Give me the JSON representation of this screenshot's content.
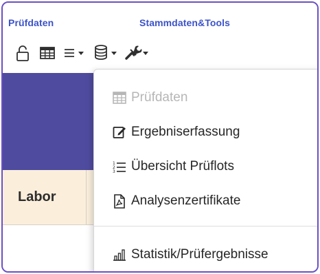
{
  "toolbar": {
    "group1_title": "Prüfdaten",
    "group2_title": "Stammdaten&Tools",
    "icons": [
      "unlock-icon",
      "table-icon",
      "list-dropdown-icon",
      "database-dropdown-icon",
      "tools-dropdown-icon"
    ]
  },
  "table": {
    "labor_header": "Labor"
  },
  "menu": {
    "items": [
      {
        "label": "Prüfdaten",
        "icon": "table-icon",
        "enabled": false
      },
      {
        "label": "Ergebniserfassung",
        "icon": "edit-icon",
        "enabled": true
      },
      {
        "label": "Übersicht Prüflots",
        "icon": "numbered-list-icon",
        "enabled": true
      },
      {
        "label": "Analysenzertifikate",
        "icon": "pdf-file-icon",
        "enabled": true
      },
      {
        "label": "Statistik/Prüfergebnisse",
        "icon": "bar-chart-icon",
        "enabled": true
      }
    ]
  },
  "colors": {
    "accent_purple": "#6a4fc2",
    "group_title_blue": "#3b52c9",
    "band": "#4f4b9f",
    "labor_cell_bg": "#fbefdc"
  }
}
